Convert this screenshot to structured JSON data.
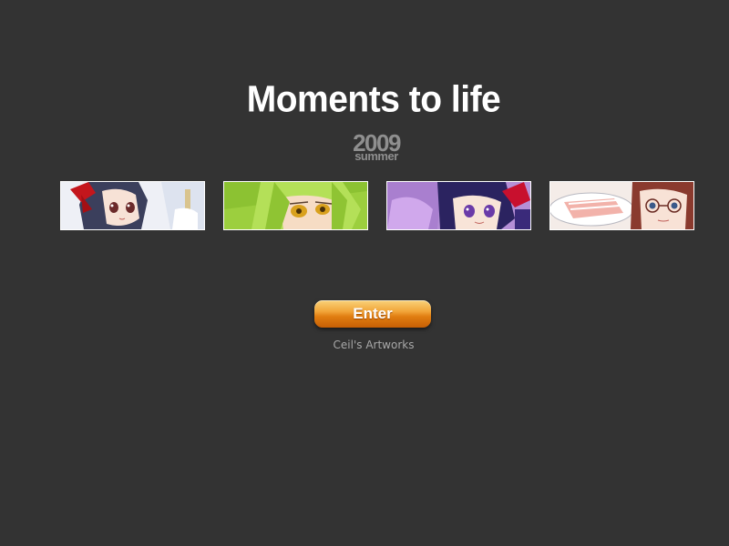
{
  "header": {
    "title": "Moments to life",
    "year": "2009",
    "season": "summer"
  },
  "thumbnails": [
    {
      "name": "gallery-thumbnail-1",
      "icon": "anime-girl-dark-hair-red-ribbon"
    },
    {
      "name": "gallery-thumbnail-2",
      "icon": "anime-girl-green-hair"
    },
    {
      "name": "gallery-thumbnail-3",
      "icon": "anime-girl-purple-hair"
    },
    {
      "name": "gallery-thumbnail-4",
      "icon": "anime-girl-glasses-cake"
    }
  ],
  "enter_button": {
    "label": "Enter",
    "accent_color": "#e07d10"
  },
  "footer": {
    "credit": "Ceil's Artworks"
  },
  "colors": {
    "background": "#333333",
    "title": "#ffffff",
    "year": "#8f8f8f",
    "credit": "#a8a8a8"
  }
}
